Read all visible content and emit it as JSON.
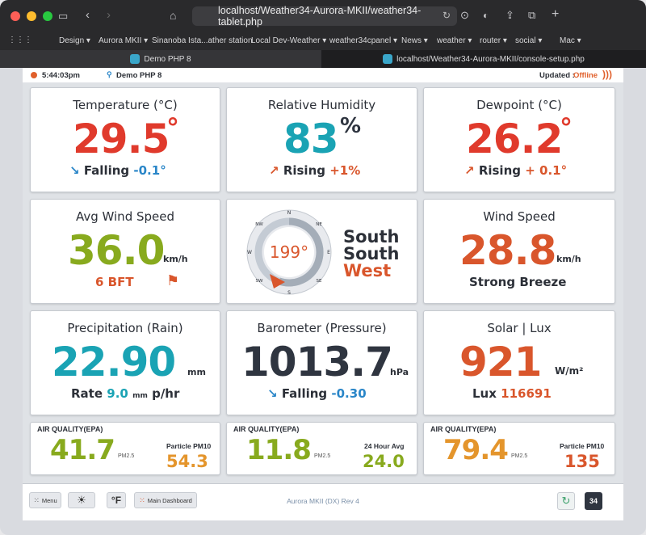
{
  "browser": {
    "url": "localhost/Weather34-Aurora-MKII/weather34-tablet.php",
    "bookmarks": [
      "Design",
      "Aurora MKII",
      "Sinanoba Ista...ather station",
      "Local Dev-Weather",
      "weather34cpanel",
      "News",
      "weather",
      "router",
      "social",
      "Mac"
    ],
    "tabs": [
      "Demo PHP 8",
      "localhost/Weather34-Aurora-MKII/console-setup.php"
    ]
  },
  "topstrip": {
    "time": "5:44:03pm",
    "location": "Demo PHP 8",
    "updated_label": "Updated :",
    "updated_status": "Offline"
  },
  "temperature": {
    "title": "Temperature (°C)",
    "value": "29.5",
    "unit": "°",
    "trend": "Falling",
    "delta": "-0.1°"
  },
  "humidity": {
    "title": "Relative Humidity",
    "value": "83",
    "unit": "%",
    "trend": "Rising",
    "delta": "+1%"
  },
  "dewpoint": {
    "title": "Dewpoint (°C)",
    "value": "26.2",
    "unit": "°",
    "trend": "Rising",
    "delta": "+ 0.1°"
  },
  "avgwind": {
    "title": "Avg Wind Speed",
    "value": "36.0",
    "unit": "km/h",
    "bft": "6 BFT"
  },
  "compass": {
    "degrees": "199°",
    "dir1": "South",
    "dir2": "South",
    "dir3": "West",
    "labels": [
      "N",
      "NE",
      "E",
      "SE",
      "S",
      "SW",
      "W",
      "NW"
    ]
  },
  "windspeed": {
    "title": "Wind Speed",
    "value": "28.8",
    "unit": "km/h",
    "desc": "Strong Breeze"
  },
  "rain": {
    "title": "Precipitation (Rain)",
    "value": "22.90",
    "unit": "mm",
    "rate_label": "Rate",
    "rate_value": "9.0",
    "rate_unit1": "mm",
    "rate_unit2": "p/hr"
  },
  "pressure": {
    "title": "Barometer (Pressure)",
    "value": "1013.7",
    "unit": "hPa",
    "trend": "Falling",
    "delta": "-0.30"
  },
  "solar": {
    "title": "Solar | Lux",
    "value": "921",
    "unit": "W/m²",
    "lux_label": "Lux",
    "lux_value": "116691"
  },
  "aq1": {
    "label": "AIR QUALITY(EPA)",
    "value": "41.7",
    "pm": "PM2.5",
    "right_label": "Particle PM10",
    "right_value": "54.3"
  },
  "aq2": {
    "label": "AIR QUALITY(EPA)",
    "value": "11.8",
    "pm": "PM2.5",
    "right_label": "24 Hour Avg",
    "right_value": "24.0"
  },
  "aq3": {
    "label": "AIR QUALITY(EPA)",
    "value": "79.4",
    "pm": "PM2.5",
    "right_label": "Particle PM10",
    "right_value": "135"
  },
  "footer": {
    "menu": "Menu",
    "unit_toggle": "°F",
    "dashboard": "Main Dashboard",
    "version": "Aurora MKII (DX) Rev 4",
    "logo_text": "34"
  }
}
